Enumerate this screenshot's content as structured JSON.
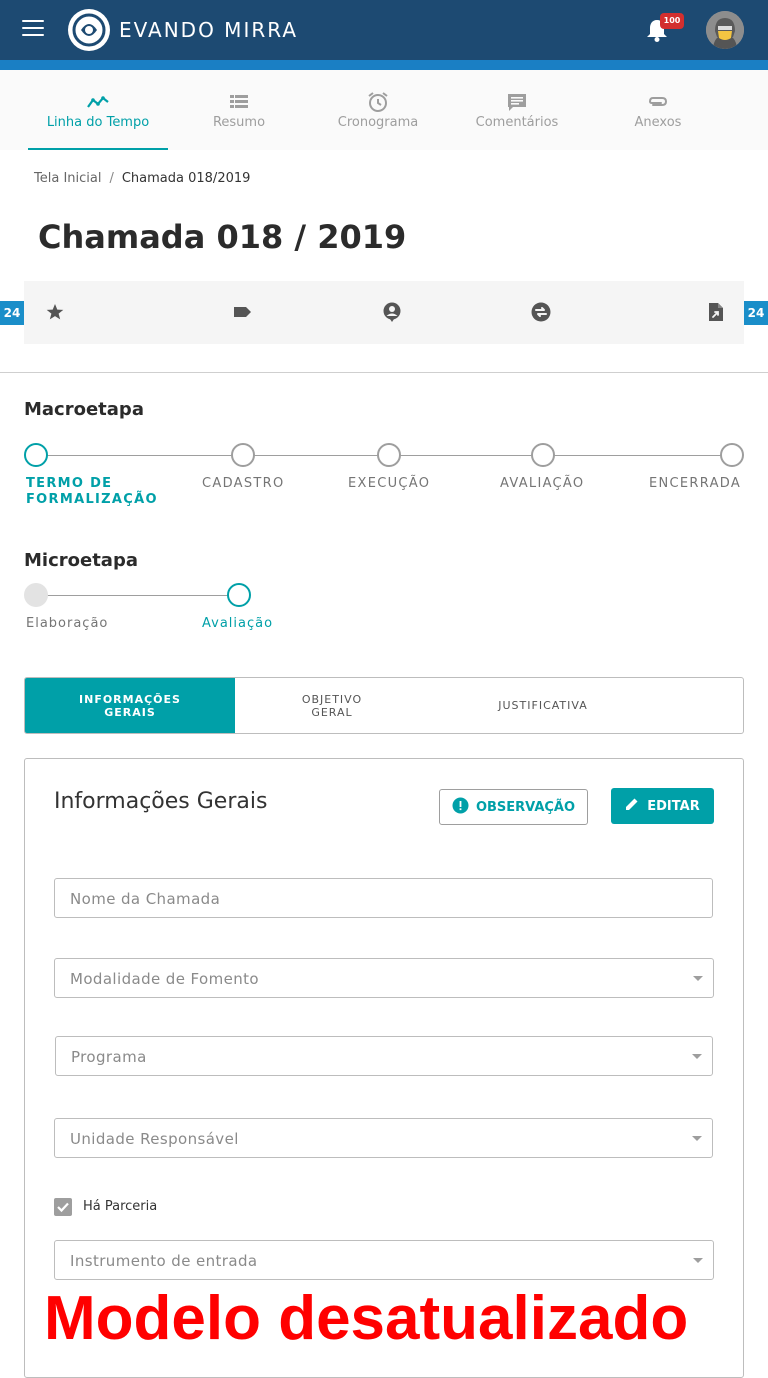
{
  "header": {
    "brand_name": "EVANDO MIRRA",
    "notification_count": "100",
    "menu_icon": "hamburger-menu-icon",
    "bell_icon": "bell-icon"
  },
  "tabs": [
    {
      "label": "Linha do Tempo",
      "icon": "timeline-icon",
      "active": true
    },
    {
      "label": "Resumo",
      "icon": "list-icon"
    },
    {
      "label": "Cronograma",
      "icon": "alarm-clock-icon"
    },
    {
      "label": "Comentários",
      "icon": "comment-icon"
    },
    {
      "label": "Anexos",
      "icon": "paperclip-icon"
    }
  ],
  "breadcrumb": {
    "home": "Tela Inicial",
    "separator": "/",
    "current": "Chamada 018/2019"
  },
  "page_title": "Chamada 018 / 2019",
  "action_bar": {
    "left_badge": "24",
    "right_badge": "24",
    "icons": [
      "star-icon",
      "label-tag-icon",
      "account-pin-icon",
      "swap-circle-icon",
      "file-export-icon"
    ]
  },
  "macro": {
    "title": "Macroetapa",
    "steps": [
      {
        "label_line1": "TERMO DE",
        "label_line2": "FORMALIZAÇÃO",
        "state": "active"
      },
      {
        "label_line1": "CADASTRO",
        "label_line2": "",
        "state": "pending"
      },
      {
        "label_line1": "EXECUÇÃO",
        "label_line2": "",
        "state": "pending"
      },
      {
        "label_line1": "AVALIAÇÃO",
        "label_line2": "",
        "state": "pending"
      },
      {
        "label_line1": "ENCERRADA",
        "label_line2": "",
        "state": "pending"
      }
    ]
  },
  "micro": {
    "title": "Microetapa",
    "steps": [
      {
        "label": "Elaboração",
        "state": "done"
      },
      {
        "label": "Avaliação",
        "state": "active"
      }
    ]
  },
  "inner_tabs": [
    {
      "line1": "INFORMAÇÕES",
      "line2": "GERAIS",
      "active": true
    },
    {
      "line1": "OBJETIVO",
      "line2": "GERAL"
    },
    {
      "line1": "JUSTIFICATIVA",
      "line2": ""
    }
  ],
  "card": {
    "title": "Informações Gerais",
    "observation_button": "OBSERVAÇÃO",
    "edit_button": "EDITAR"
  },
  "fields": {
    "nome": "Nome da Chamada",
    "modalidade": "Modalidade de Fomento",
    "programa": "Programa",
    "unidade": "Unidade Responsável",
    "instrumento": "Instrumento de entrada"
  },
  "checkbox": {
    "label": "Há Parceria",
    "checked": true
  },
  "watermark": "Modelo desatualizado",
  "colors": {
    "header": "#1d4a72",
    "header_stripe": "#1a7fc4",
    "accent": "#00a0a8",
    "badge_blue": "#1a8ec9",
    "notification_red": "#d32f2f",
    "watermark_red": "#ff0000"
  }
}
